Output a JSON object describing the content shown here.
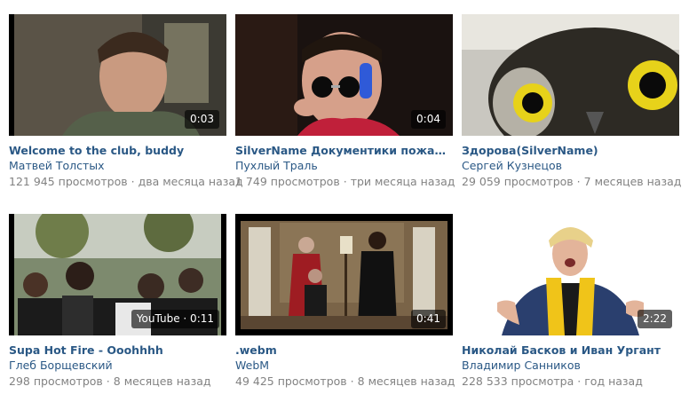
{
  "videos": [
    {
      "title": "Welcome to the club, buddy",
      "author": "Матвей Толстых",
      "views": "121 945 просмотров",
      "date": "два месяца назад",
      "duration": "0:03",
      "thumb_icon": "man-smiling-thumbnail"
    },
    {
      "title": "SilverName Документики пожалуйста! ...",
      "author": "Пухлый Траль",
      "views": "1 749 просмотров",
      "date": "три месяца назад",
      "duration": "0:04",
      "thumb_icon": "streamer-sunglasses-thumbnail"
    },
    {
      "title": "Здорова(SilverName)",
      "author": "Сергей Кузнецов",
      "views": "29 059 просмотров",
      "date": "7 месяцев назад",
      "duration": "",
      "thumb_icon": "owl-closeup-thumbnail"
    },
    {
      "title": "Supa Hot Fire - Ooohhhh",
      "author": "Глеб Борщевский",
      "views": "298 просмотров",
      "date": "8 месяцев назад",
      "duration": "YouTube · 0:11",
      "thumb_icon": "rap-battle-crowd-thumbnail"
    },
    {
      "title": ".webm",
      "author": "WebM",
      "views": "49 425 просмотров",
      "date": "8 месяцев назад",
      "duration": "0:41",
      "thumb_icon": "room-scene-thumbnail"
    },
    {
      "title": "Николай Басков и Иван Ургант",
      "author": "Владимир Санников",
      "views": "228 533 просмотра",
      "date": "год назад",
      "duration": "2:22",
      "thumb_icon": "singer-yellow-scarf-thumbnail"
    }
  ],
  "separator": "·",
  "colors": {
    "link": "#2a5885",
    "meta": "#828282",
    "badge_bg": "rgba(0,0,0,0.62)"
  }
}
